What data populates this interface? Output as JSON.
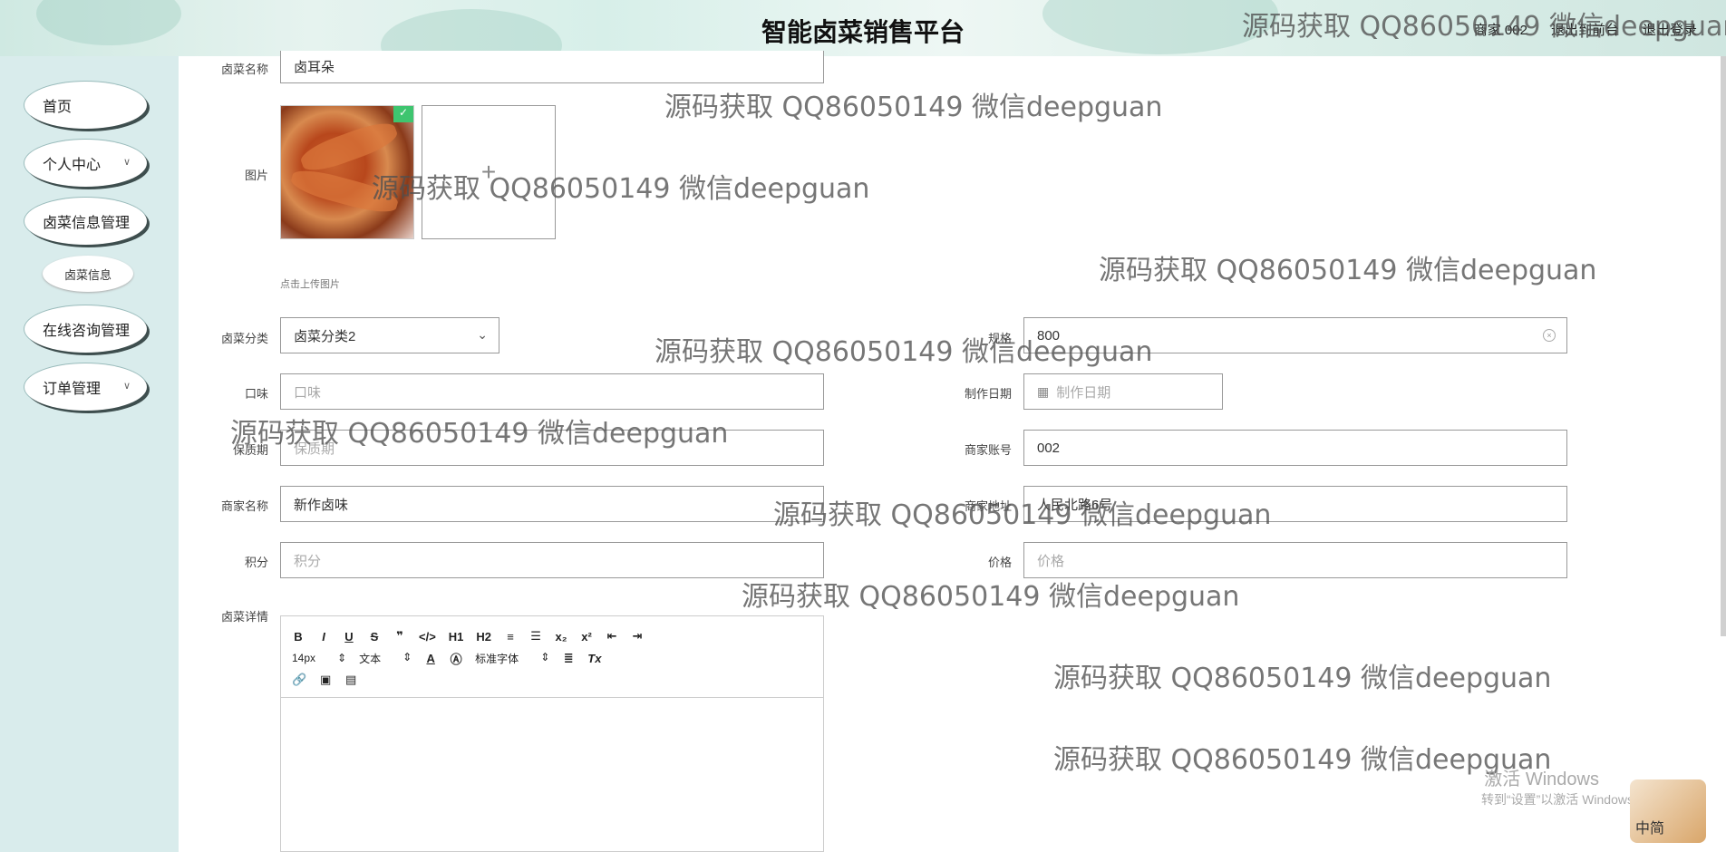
{
  "header": {
    "title": "智能卤菜销售平台",
    "user_label": "商家 002",
    "back_label": "退出到前台",
    "logout_label": "退出登录"
  },
  "sidebar": {
    "items": [
      {
        "label": "首页"
      },
      {
        "label": "个人中心"
      },
      {
        "label": "卤菜信息管理"
      },
      {
        "label": "卤菜信息"
      },
      {
        "label": "在线咨询管理"
      },
      {
        "label": "订单管理"
      }
    ]
  },
  "form": {
    "name_label": "卤菜名称",
    "name_value": "卤耳朵",
    "image_label": "图片",
    "upload_hint": "点击上传图片",
    "category_label": "卤菜分类",
    "category_value": "卤菜分类2",
    "spec_label": "规格",
    "spec_value": "800",
    "taste_label": "口味",
    "taste_placeholder": "口味",
    "date_label": "制作日期",
    "date_placeholder": "制作日期",
    "shelf_label": "保质期",
    "shelf_placeholder": "保质期",
    "account_label": "商家账号",
    "account_value": "002",
    "merchant_label": "商家名称",
    "merchant_value": "新作卤味",
    "address_label": "商家地址",
    "address_value": "人民北路6号",
    "points_label": "积分",
    "points_placeholder": "积分",
    "price_label": "价格",
    "price_placeholder": "价格",
    "detail_label": "卤菜详情"
  },
  "editor": {
    "row1": [
      "B",
      "I",
      "U",
      "S",
      "❞",
      "</>",
      "H1",
      "H2",
      "≡",
      "☰",
      "x₂",
      "x²",
      "⇤",
      "⇥"
    ],
    "font_size": "14px",
    "text_type": "文本",
    "font_family": "标准字体"
  },
  "watermark": "源码获取 QQ86050149 微信deepguan",
  "windows": {
    "line1": "激活 Windows",
    "line2": "转到“设置”以激活 Windows。"
  },
  "ime_label": "中简"
}
